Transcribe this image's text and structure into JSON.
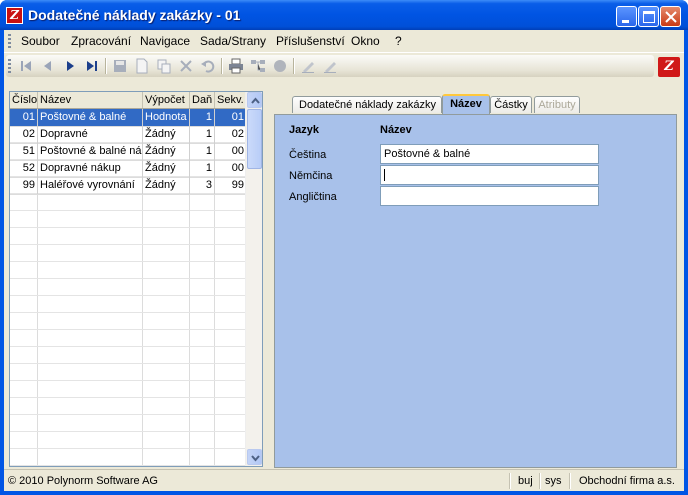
{
  "window": {
    "title": "Dodatečné náklady zakázky - 01",
    "app_icon": "app-logo-icon"
  },
  "menu": [
    "Soubor",
    "Zpracování",
    "Navigace",
    "Sada/Strany",
    "Příslušenství",
    "Okno",
    "?"
  ],
  "grid": {
    "columns": [
      "Číslo",
      "Název",
      "Výpočet",
      "Daň",
      "Sekv."
    ],
    "rows": [
      {
        "cislo": "01",
        "nazev": "Poštovné & balné",
        "vypocet": "Hodnota",
        "dan": "1",
        "sekv": "01",
        "selected": true
      },
      {
        "cislo": "02",
        "nazev": "Dopravné",
        "vypocet": "Žádný",
        "dan": "1",
        "sekv": "02"
      },
      {
        "cislo": "51",
        "nazev": "Poštovné & balné nák",
        "vypocet": "Žádný",
        "dan": "1",
        "sekv": "00"
      },
      {
        "cislo": "52",
        "nazev": "Dopravné nákup",
        "vypocet": "Žádný",
        "dan": "1",
        "sekv": "00"
      },
      {
        "cislo": "99",
        "nazev": "Haléřové vyrovnání",
        "vypocet": "Žádný",
        "dan": "3",
        "sekv": "99"
      }
    ]
  },
  "tabs": [
    "Dodatečné náklady zakázky",
    "Název",
    "Částky",
    "Atributy"
  ],
  "names_form": {
    "header_lang": "Jazyk",
    "header_name": "Název",
    "rows": [
      {
        "lang": "Čeština",
        "value": "Poštovné & balné"
      },
      {
        "lang": "Němčina",
        "value": ""
      },
      {
        "lang": "Angličtina",
        "value": ""
      }
    ]
  },
  "status": {
    "copyright": "© 2010 Polynorm Software AG",
    "user": "buj",
    "db": "sys",
    "company": "Obchodní firma a.s."
  },
  "colors": {
    "title_bar": "#0054e3",
    "selection": "#316ac5",
    "panel": "#a8c1ea",
    "frame": "#ece9d8"
  }
}
